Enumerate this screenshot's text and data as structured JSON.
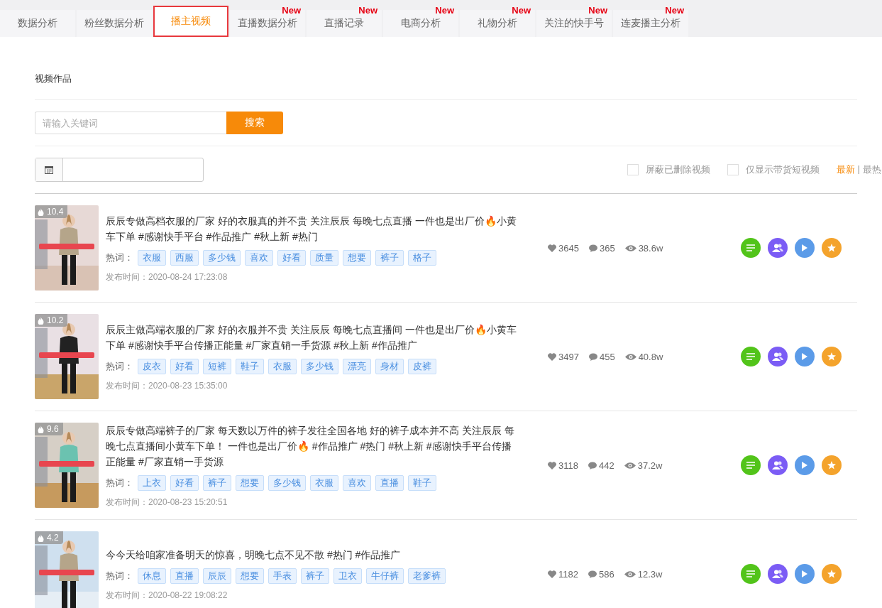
{
  "tabs": [
    {
      "label": "数据分析",
      "selected": false
    },
    {
      "label": "粉丝数据分析",
      "selected": false
    },
    {
      "label": "播主视频",
      "selected": true
    },
    {
      "label": "直播数据分析",
      "selected": false,
      "badge": "New"
    },
    {
      "label": "直播记录",
      "selected": false,
      "badge": "New"
    },
    {
      "label": "电商分析",
      "selected": false,
      "badge": "New"
    },
    {
      "label": "礼物分析",
      "selected": false,
      "badge": "New"
    },
    {
      "label": "关注的快手号",
      "selected": false,
      "badge": "New"
    },
    {
      "label": "连麦播主分析",
      "selected": false,
      "badge": "New"
    }
  ],
  "section_title": "视频作品",
  "search": {
    "placeholder": "请输入关键词",
    "button": "搜索"
  },
  "filters": [
    {
      "label": "屏蔽已删除视频",
      "checked": false
    },
    {
      "label": "仅显示带货短视频",
      "checked": false
    }
  ],
  "sort_separator": "|",
  "sort": [
    {
      "label": "最新",
      "selected": true
    },
    {
      "label": "最热",
      "selected": false
    }
  ],
  "videos": [
    {
      "heat": "10.4",
      "title": "辰辰专做高档衣服的厂家 好的衣服真的并不贵 关注辰辰 每晚七点直播 一件也是出厂价🔥小黄车下单 #感谢快手平台 #作品推广 #秋上新 #热门",
      "keywords_label": "热词：",
      "keywords": [
        "衣服",
        "西服",
        "多少钱",
        "喜欢",
        "好看",
        "质量",
        "想要",
        "裤子",
        "格子"
      ],
      "published": "发布时间：2020-08-24 17:23:08",
      "likes": "3645",
      "comments": "365",
      "views": "38.6w"
    },
    {
      "heat": "10.2",
      "title": "辰辰主做高端衣服的厂家 好的衣服并不贵 关注辰辰 每晚七点直播间 一件也是出厂价🔥小黄车下单 #感谢快手平台传播正能量 #厂家直销一手货源 #秋上新 #作品推广",
      "keywords_label": "热词：",
      "keywords": [
        "皮衣",
        "好看",
        "短裤",
        "鞋子",
        "衣服",
        "多少钱",
        "漂亮",
        "身材",
        "皮裤"
      ],
      "published": "发布时间：2020-08-23 15:35:00",
      "likes": "3497",
      "comments": "455",
      "views": "40.8w"
    },
    {
      "heat": "9.6",
      "title": "辰辰专做高端裤子的厂家 每天数以万件的裤子发往全国各地 好的裤子成本并不高 关注辰辰 每晚七点直播间小黄车下单！ 一件也是出厂价🔥 #作品推广 #热门 #秋上新 #感谢快手平台传播正能量 #厂家直销一手货源",
      "keywords_label": "热词：",
      "keywords": [
        "上衣",
        "好看",
        "裤子",
        "想要",
        "多少钱",
        "衣服",
        "喜欢",
        "直播",
        "鞋子"
      ],
      "published": "发布时间：2020-08-23 15:20:51",
      "likes": "3118",
      "comments": "442",
      "views": "37.2w"
    },
    {
      "heat": "4.2",
      "title": "今今天给咱家准备明天的惊喜，明晚七点不见不散 #热门 #作品推广",
      "keywords_label": "热词：",
      "keywords": [
        "休息",
        "直播",
        "辰辰",
        "想要",
        "手表",
        "裤子",
        "卫衣",
        "牛仔裤",
        "老爹裤"
      ],
      "published": "发布时间：2020-08-22 19:08:22",
      "likes": "1182",
      "comments": "586",
      "views": "12.3w"
    }
  ]
}
